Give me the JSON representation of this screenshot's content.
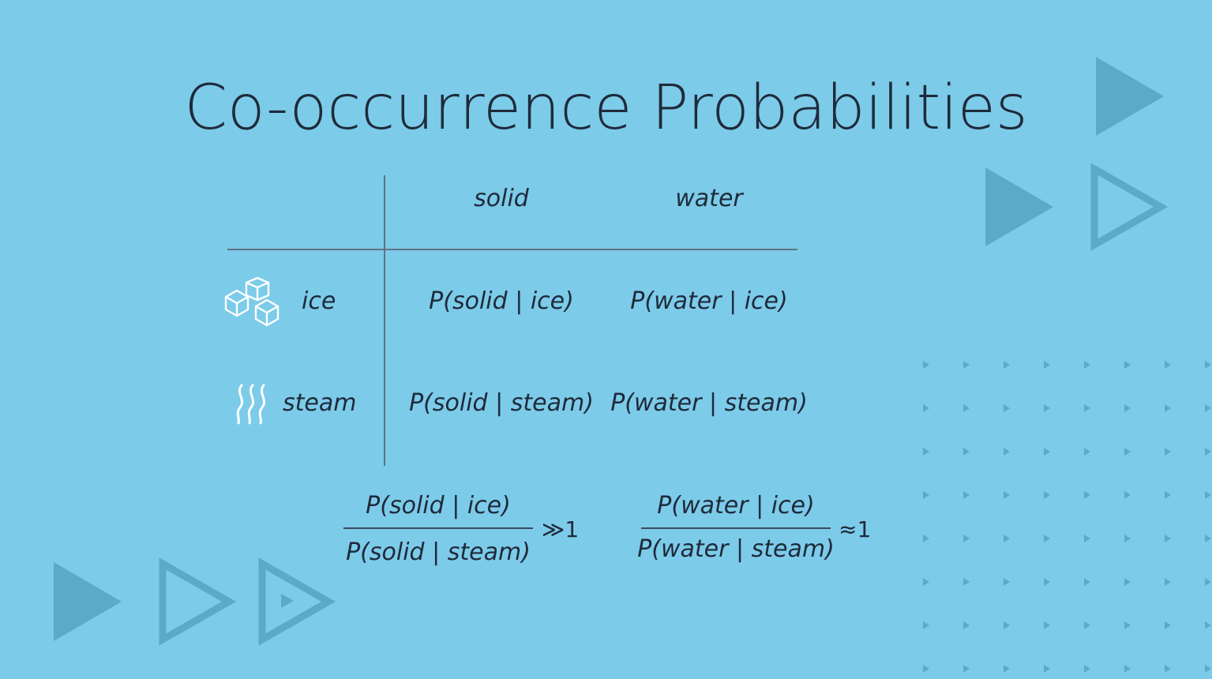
{
  "slide": {
    "title": "Co-occurrence Probabilities",
    "columns": [
      "solid",
      "water"
    ],
    "rows": [
      {
        "label": "ice",
        "icon": "ice-cubes-icon",
        "cells": [
          "P(solid | ice)",
          "P(water | ice)"
        ]
      },
      {
        "label": "steam",
        "icon": "steam-icon",
        "cells": [
          "P(solid | steam)",
          "P(water | steam)"
        ]
      }
    ],
    "ratios": [
      {
        "numerator": "P(solid | ice)",
        "denominator": "P(solid | steam)",
        "relation": "≫1"
      },
      {
        "numerator": "P(water | ice)",
        "denominator": "P(water | steam)",
        "relation": "≈1"
      }
    ]
  },
  "colors": {
    "background": "#7ccbe9",
    "text": "#1f2a3a",
    "decoration": "#5aaac8",
    "icon": "#ffffff"
  }
}
